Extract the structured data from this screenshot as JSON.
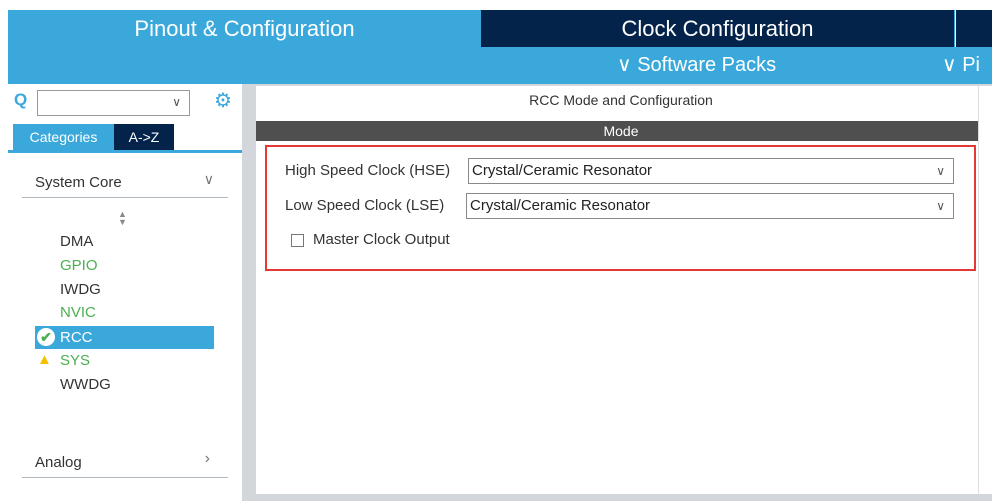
{
  "tabs": {
    "pinout": "Pinout & Configuration",
    "clock": "Clock Configuration"
  },
  "subbar": {
    "software_packs": "Software Packs",
    "pinout_partial": "Pi"
  },
  "sidebar": {
    "search": {
      "value": "",
      "placeholder": ""
    },
    "view_tabs": [
      "Categories",
      "A->Z"
    ],
    "groups": [
      {
        "label": "System Core",
        "expanded": true
      },
      {
        "label": "Analog",
        "expanded": false
      }
    ],
    "items": [
      {
        "label": "DMA",
        "color": "#333333",
        "status": ""
      },
      {
        "label": "GPIO",
        "color": "#4caf50",
        "status": ""
      },
      {
        "label": "IWDG",
        "color": "#333333",
        "status": ""
      },
      {
        "label": "NVIC",
        "color": "#4caf50",
        "status": ""
      },
      {
        "label": "RCC",
        "color": "#ffffff",
        "status": "ok",
        "selected": true
      },
      {
        "label": "SYS",
        "color": "#4caf50",
        "status": "warning"
      },
      {
        "label": "WWDG",
        "color": "#333333",
        "status": ""
      }
    ]
  },
  "main": {
    "title": "RCC Mode and Configuration",
    "mode_header": "Mode",
    "hse": {
      "label": "High Speed Clock (HSE)",
      "value": "Crystal/Ceramic Resonator"
    },
    "lse": {
      "label": "Low Speed Clock (LSE)",
      "value": "Crystal/Ceramic Resonator"
    },
    "mco": {
      "label": "Master Clock Output",
      "checked": false
    }
  },
  "colors": {
    "accent": "#3aa8db",
    "dark": "#03234b",
    "highlight": "#e53935"
  }
}
